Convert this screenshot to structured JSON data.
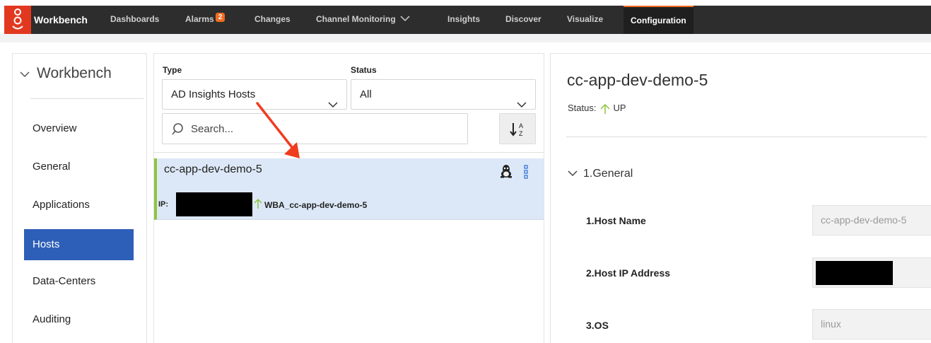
{
  "topnav": {
    "brand": "Workbench",
    "items": [
      {
        "label": "Dashboards"
      },
      {
        "label": "Alarms",
        "badge": "2"
      },
      {
        "label": "Changes"
      },
      {
        "label": "Channel Monitoring"
      },
      {
        "label": "Insights"
      },
      {
        "label": "Discover"
      },
      {
        "label": "Visualize"
      },
      {
        "label": "Configuration",
        "active": true
      }
    ]
  },
  "sidebar": {
    "title": "Workbench",
    "items": [
      {
        "label": "Overview"
      },
      {
        "label": "General"
      },
      {
        "label": "Applications"
      },
      {
        "label": "Hosts",
        "active": true
      },
      {
        "label": "Data-Centers"
      },
      {
        "label": "Auditing"
      }
    ]
  },
  "filters": {
    "type_label": "Type",
    "type_value": "AD Insights Hosts",
    "status_label": "Status",
    "status_value": "All",
    "search_placeholder": "Search..."
  },
  "host_list": [
    {
      "name": "cc-app-dev-demo-5",
      "ip_label": "IP:",
      "app": "WBA_cc-app-dev-demo-5"
    }
  ],
  "detail": {
    "title": "cc-app-dev-demo-5",
    "status_label": "Status:",
    "status_value": "UP",
    "section": "1.General",
    "fields": [
      {
        "label": "1.Host Name",
        "value": "cc-app-dev-demo-5"
      },
      {
        "label": "2.Host IP Address",
        "value": ""
      },
      {
        "label": "3.OS",
        "value": "linux"
      }
    ]
  },
  "colors": {
    "accent": "#f26b21",
    "active_nav": "#2e5fb8",
    "selected_row": "#dce8f7",
    "status_up": "#8fc33f",
    "annotation": "#f03c1e"
  }
}
